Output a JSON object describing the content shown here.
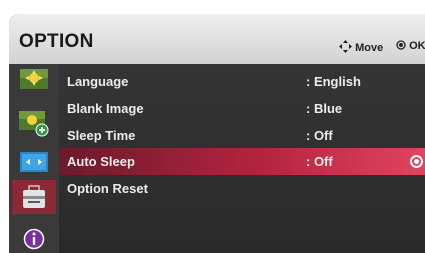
{
  "header": {
    "title": "OPTION",
    "move_hint": "Move",
    "ok_hint": "OK"
  },
  "sidebar": {
    "icons": [
      "picture-icon",
      "picture-add-icon",
      "screen-icon",
      "toolbox-icon",
      "info-icon"
    ]
  },
  "menu": {
    "items": [
      {
        "label": "Language",
        "value": ": English"
      },
      {
        "label": "Blank Image",
        "value": ": Blue"
      },
      {
        "label": "Sleep Time",
        "value": ": Off"
      },
      {
        "label": "Auto Sleep",
        "value": ": Off",
        "selected": true
      },
      {
        "label": "Option Reset",
        "value": ""
      }
    ]
  },
  "colors": {
    "highlight": "#b3243f",
    "panel": "#2a2a2a",
    "header": "#e0e0e0"
  }
}
